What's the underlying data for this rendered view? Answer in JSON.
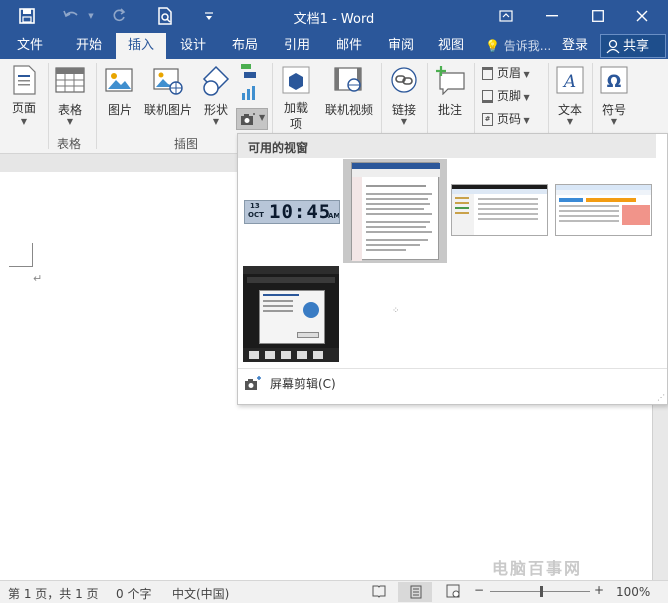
{
  "window": {
    "title": "文档1 - Word",
    "controls": {
      "ribbon_display": "ribbon-display-icon",
      "minimize": "minimize-icon",
      "maximize": "maximize-icon",
      "close": "close-icon"
    }
  },
  "quick_access": [
    "save-icon",
    "undo-icon",
    "redo-icon",
    "print-preview-icon",
    "customize-icon"
  ],
  "tabs": [
    {
      "label": "文件"
    },
    {
      "label": "开始"
    },
    {
      "label": "插入",
      "active": true
    },
    {
      "label": "设计"
    },
    {
      "label": "布局"
    },
    {
      "label": "引用"
    },
    {
      "label": "邮件"
    },
    {
      "label": "审阅"
    },
    {
      "label": "视图"
    }
  ],
  "tellme": {
    "label": "告诉我..."
  },
  "account": {
    "login": "登录",
    "share": "共享"
  },
  "ribbon": {
    "pages": {
      "label": "页面"
    },
    "table": {
      "label": "表格",
      "group": "表格"
    },
    "picture": {
      "label": "图片"
    },
    "online_picture": {
      "label": "联机图片"
    },
    "shapes": {
      "label": "形状"
    },
    "illustrations_group": "插图",
    "addins": {
      "label1": "加载",
      "label2": "项"
    },
    "online_video": {
      "label": "联机视频"
    },
    "link": {
      "label": "链接"
    },
    "comment": {
      "label": "批注"
    },
    "header": {
      "label": "页眉"
    },
    "footer": {
      "label": "页脚"
    },
    "page_number": {
      "label": "页码"
    },
    "textbox": {
      "label": "文本"
    },
    "symbols": {
      "label": "符号"
    }
  },
  "screenshot_menu": {
    "header": "可用的视窗",
    "clock": {
      "date": "13",
      "month": "OCT",
      "time": "10:45",
      "ampm": "AM"
    },
    "footer": "屏幕剪辑(C)"
  },
  "statusbar": {
    "page": "第 1 页，共 1 页",
    "words": "0 个字",
    "language": "中文(中国)",
    "zoom": "100%"
  },
  "watermark": "电脑百事网",
  "colors": {
    "brand": "#2b579a",
    "ribbon_bg": "#f3f3f3"
  }
}
